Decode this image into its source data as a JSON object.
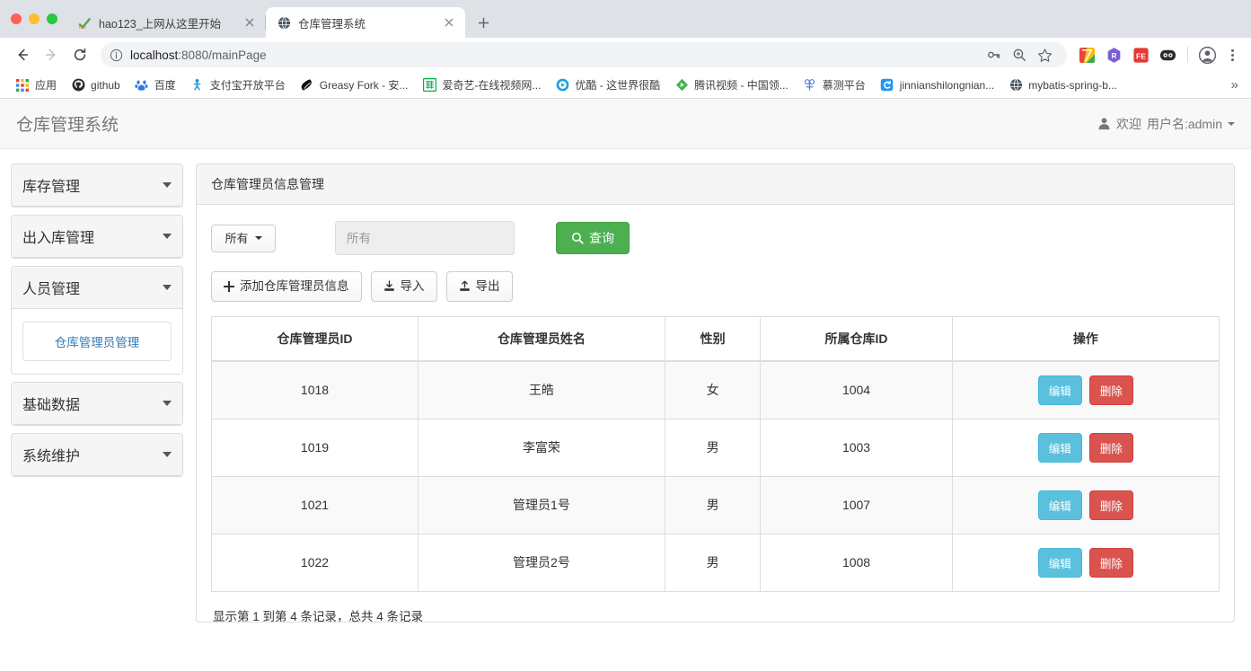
{
  "browser": {
    "tabs": [
      {
        "title": "hao123_上网从这里开始",
        "favicon": "hao123-icon",
        "active": false
      },
      {
        "title": "仓库管理系统",
        "favicon": "globe-icon",
        "active": true
      }
    ],
    "new_tab_label": "+",
    "nav": {
      "back": "←",
      "forward": "→",
      "reload": "⟳"
    },
    "omnibox": {
      "info_icon": "info-circle-icon",
      "url_host": "localhost",
      "url_path": ":8080/mainPage",
      "url_full": "localhost:8080/mainPage"
    },
    "toolbar_icons": [
      "key-icon",
      "zoom-icon",
      "star-icon"
    ],
    "extensions": [
      "colorful-seven-icon",
      "purple-hex-r-icon",
      "fe-red-icon",
      "dark-eyes-icon"
    ],
    "profile_icon": "account-circle-icon",
    "menu_icon": "three-dots-menu-icon",
    "bookmarks": [
      {
        "label": "应用",
        "icon": "apps-grid-icon"
      },
      {
        "label": "github",
        "icon": "github-icon"
      },
      {
        "label": "百度",
        "icon": "baidu-icon"
      },
      {
        "label": "支付宝开放平台",
        "icon": "alipay-icon"
      },
      {
        "label": "Greasy Fork - 安...",
        "icon": "greasyfork-icon"
      },
      {
        "label": "爱奇艺-在线视频网...",
        "icon": "iqiyi-icon"
      },
      {
        "label": "优酷 - 这世界很酷",
        "icon": "youku-icon"
      },
      {
        "label": "腾讯视频 - 中国领...",
        "icon": "tencent-video-icon"
      },
      {
        "label": "慕测平台",
        "icon": "mooctest-icon"
      },
      {
        "label": "jinnianshilongnian...",
        "icon": "csdn-icon"
      },
      {
        "label": "mybatis-spring-b...",
        "icon": "globe-icon"
      }
    ],
    "bookmarks_overflow": "»"
  },
  "app": {
    "title": "仓库管理系统",
    "user": {
      "icon": "user-icon",
      "greeting": "欢迎",
      "name": "用户名:admin"
    }
  },
  "sidebar": {
    "items": [
      {
        "label": "库存管理",
        "expanded": false,
        "children": []
      },
      {
        "label": "出入库管理",
        "expanded": false,
        "children": []
      },
      {
        "label": "人员管理",
        "expanded": true,
        "children": [
          {
            "label": "仓库管理员管理",
            "active": true
          }
        ]
      },
      {
        "label": "基础数据",
        "expanded": false,
        "children": []
      },
      {
        "label": "系统维护",
        "expanded": false,
        "children": []
      }
    ]
  },
  "main": {
    "panel_title": "仓库管理员信息管理",
    "filter": {
      "select_label": "所有",
      "input_value": "",
      "input_placeholder": "所有",
      "search_label": "查询",
      "search_icon": "search-icon"
    },
    "actions": [
      {
        "label": "添加仓库管理员信息",
        "icon": "plus-icon"
      },
      {
        "label": "导入",
        "icon": "import-icon"
      },
      {
        "label": "导出",
        "icon": "export-icon"
      }
    ],
    "table": {
      "headers": [
        "仓库管理员ID",
        "仓库管理员姓名",
        "性别",
        "所属仓库ID",
        "操作"
      ],
      "rows": [
        {
          "id": "1018",
          "name": "王皓",
          "gender": "女",
          "warehouse": "1004"
        },
        {
          "id": "1019",
          "name": "李富荣",
          "gender": "男",
          "warehouse": "1003"
        },
        {
          "id": "1021",
          "name": "管理员1号",
          "gender": "男",
          "warehouse": "1007"
        },
        {
          "id": "1022",
          "name": "管理员2号",
          "gender": "男",
          "warehouse": "1008"
        }
      ],
      "row_actions": {
        "edit": "编辑",
        "delete": "删除"
      }
    },
    "footer_text": "显示第 1 到第 4 条记录，总共 4 条记录"
  },
  "colors": {
    "search_green": "#4caf50",
    "edit_blue": "#5bc0de",
    "delete_red": "#d9534f",
    "link_blue": "#337ab7",
    "panel_gray": "#f5f5f5"
  }
}
